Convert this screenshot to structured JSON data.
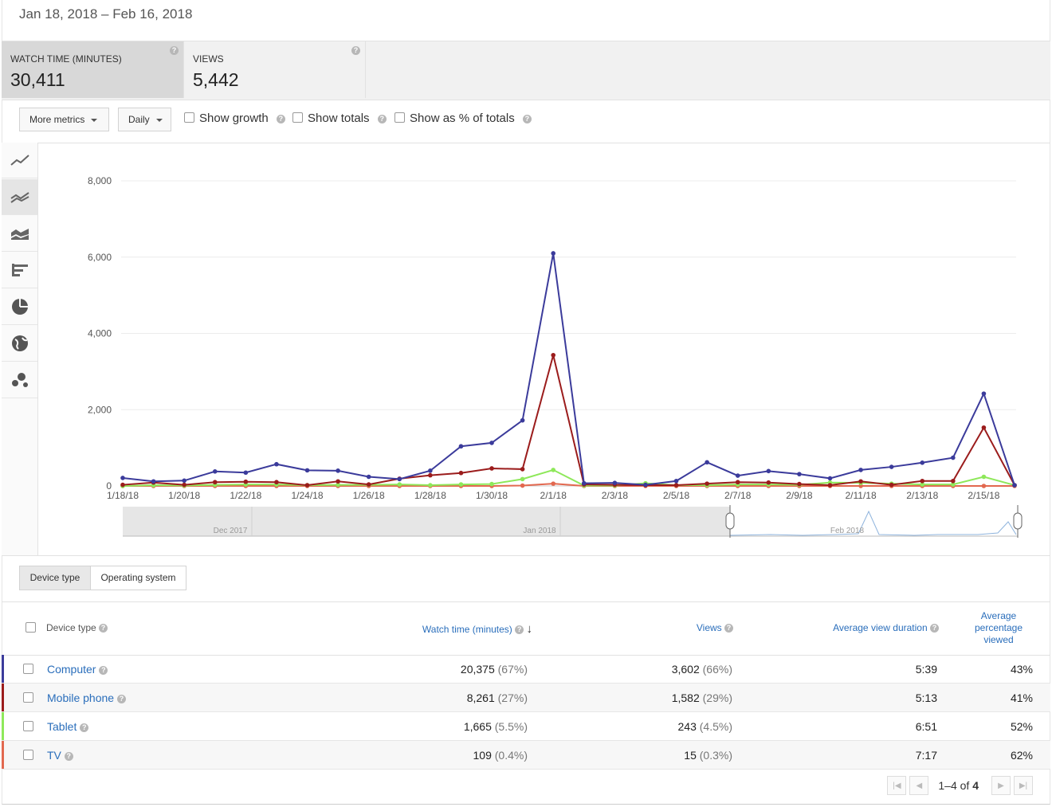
{
  "header": {
    "date_range": "Jan 18, 2018 – Feb 16, 2018"
  },
  "metric_tiles": [
    {
      "label": "WATCH TIME (MINUTES)",
      "value": "30,411",
      "active": true
    },
    {
      "label": "VIEWS",
      "value": "5,442",
      "active": false
    }
  ],
  "controls": {
    "more_metrics": "More metrics",
    "granularity": "Daily",
    "show_growth": "Show growth",
    "show_totals": "Show totals",
    "show_pct_totals": "Show as % of totals"
  },
  "rail_icons": [
    "line-chart-icon",
    "multi-line-icon",
    "stacked-area-icon",
    "bar-chart-icon",
    "pie-chart-icon",
    "globe-map-icon",
    "bubble-chart-icon"
  ],
  "chart_data": {
    "type": "line",
    "x": [
      "1/18/18",
      "1/19/18",
      "1/20/18",
      "1/21/18",
      "1/22/18",
      "1/23/18",
      "1/24/18",
      "1/25/18",
      "1/26/18",
      "1/27/18",
      "1/28/18",
      "1/29/18",
      "1/30/18",
      "1/31/18",
      "2/1/18",
      "2/2/18",
      "2/3/18",
      "2/4/18",
      "2/5/18",
      "2/6/18",
      "2/7/18",
      "2/8/18",
      "2/9/18",
      "2/10/18",
      "2/11/18",
      "2/12/18",
      "2/13/18",
      "2/14/18",
      "2/15/18",
      "2/16/18"
    ],
    "x_tick_labels": [
      "1/18/18",
      "1/20/18",
      "1/22/18",
      "1/24/18",
      "1/26/18",
      "1/28/18",
      "1/30/18",
      "2/1/18",
      "2/3/18",
      "2/5/18",
      "2/7/18",
      "2/9/18",
      "2/11/18",
      "2/13/18",
      "2/15/18"
    ],
    "y_tick_labels": [
      "0",
      "2,000",
      "4,000",
      "6,000",
      "8,000"
    ],
    "ylim": [
      0,
      8000
    ],
    "grid": true,
    "series": [
      {
        "name": "Computer",
        "color": "#3b3b9b",
        "values": [
          210,
          120,
          140,
          380,
          350,
          570,
          410,
          400,
          240,
          180,
          400,
          1040,
          1130,
          1720,
          6100,
          70,
          80,
          30,
          130,
          620,
          270,
          390,
          310,
          200,
          420,
          500,
          610,
          740,
          2420,
          20
        ]
      },
      {
        "name": "Mobile phone",
        "color": "#9b1c1c",
        "values": [
          30,
          90,
          30,
          100,
          110,
          100,
          20,
          120,
          40,
          190,
          280,
          340,
          460,
          440,
          3430,
          40,
          30,
          20,
          20,
          60,
          100,
          90,
          50,
          20,
          120,
          30,
          130,
          130,
          1530,
          20
        ]
      },
      {
        "name": "Tablet",
        "color": "#8ee85a",
        "values": [
          0,
          20,
          10,
          30,
          40,
          40,
          20,
          30,
          30,
          40,
          20,
          40,
          50,
          180,
          420,
          10,
          10,
          70,
          20,
          20,
          40,
          40,
          30,
          90,
          80,
          60,
          40,
          40,
          240,
          20
        ]
      },
      {
        "name": "TV",
        "color": "#e2684f",
        "values": [
          0,
          0,
          0,
          0,
          0,
          0,
          0,
          0,
          0,
          0,
          0,
          0,
          0,
          10,
          60,
          0,
          0,
          0,
          0,
          0,
          0,
          0,
          0,
          0,
          0,
          0,
          0,
          0,
          0,
          0
        ]
      }
    ],
    "navigator_labels": [
      "Dec 2017",
      "Jan 2018",
      "Feb 2018"
    ]
  },
  "sub_tabs": [
    "Device type",
    "Operating system"
  ],
  "table": {
    "headers": {
      "name": "Device type",
      "watch": "Watch time (minutes)",
      "views": "Views",
      "avd": "Average view duration",
      "apv_line1": "Average",
      "apv_line2": "percentage",
      "apv_line3": "viewed"
    },
    "rows": [
      {
        "name": "Computer",
        "color": "#3b3b9b",
        "watch": "20,375",
        "watch_pct": "(67%)",
        "views": "3,602",
        "views_pct": "(66%)",
        "avd": "5:39",
        "apv": "43%"
      },
      {
        "name": "Mobile phone",
        "color": "#9b1c1c",
        "watch": "8,261",
        "watch_pct": "(27%)",
        "views": "1,582",
        "views_pct": "(29%)",
        "avd": "5:13",
        "apv": "41%"
      },
      {
        "name": "Tablet",
        "color": "#8ee85a",
        "watch": "1,665",
        "watch_pct": "(5.5%)",
        "views": "243",
        "views_pct": "(4.5%)",
        "avd": "6:51",
        "apv": "52%"
      },
      {
        "name": "TV",
        "color": "#e2684f",
        "watch": "109",
        "watch_pct": "(0.4%)",
        "views": "15",
        "views_pct": "(0.3%)",
        "avd": "7:17",
        "apv": "62%"
      }
    ]
  },
  "pager": {
    "range": "1–4",
    "of": "of",
    "total": "4"
  }
}
